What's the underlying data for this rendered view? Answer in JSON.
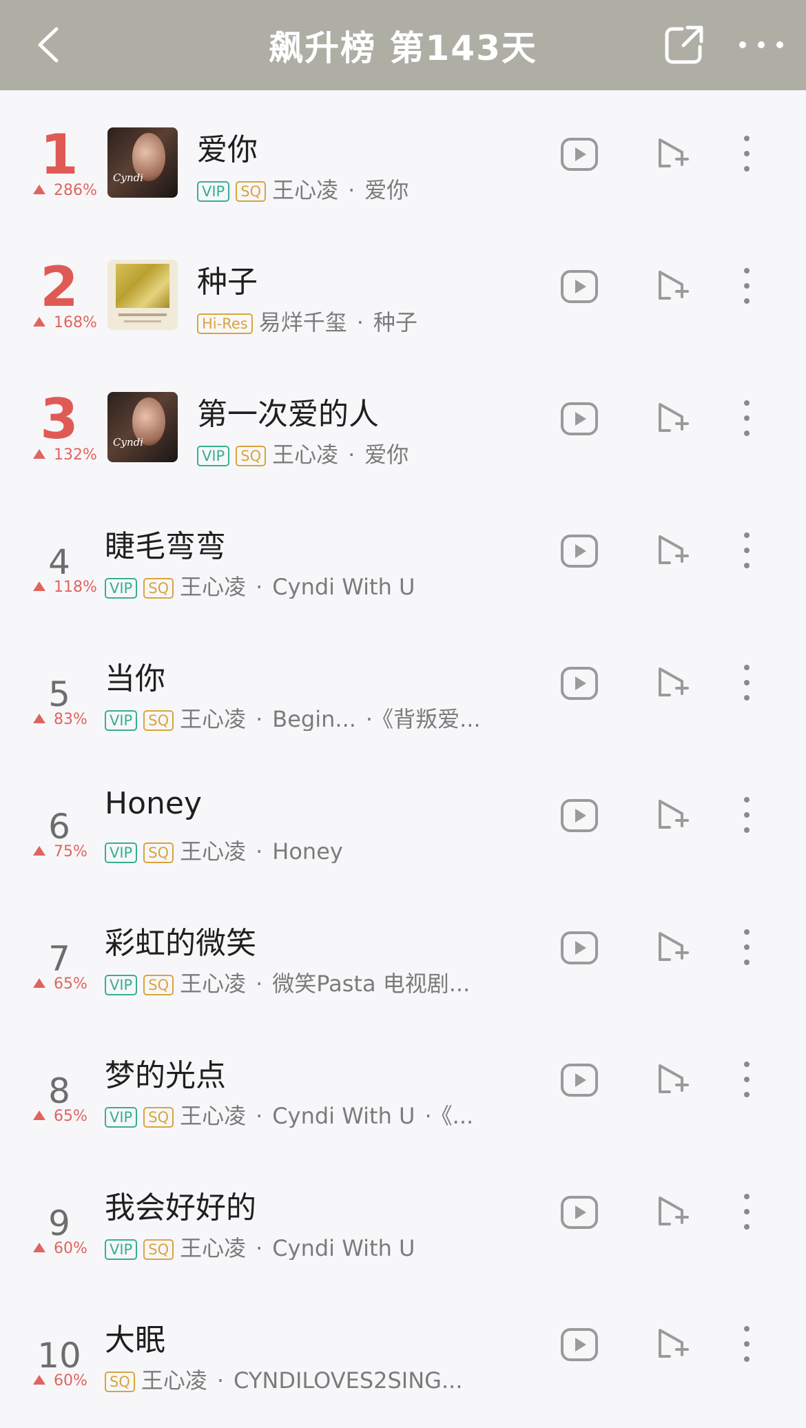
{
  "header": {
    "title": "飙升榜 第143天",
    "icons": {
      "back": "chevron-left-icon",
      "share": "share-icon",
      "more": "more-horizontal-icon"
    }
  },
  "colors": {
    "header_bg": "#aeaea5",
    "rank_highlight": "#e05a55",
    "rise": "#e0645e",
    "vip": "#36b08c",
    "sq": "#d9a43c"
  },
  "songs": [
    {
      "rank": "1",
      "change": "286%",
      "title": "爱你",
      "tags": [
        "VIP",
        "SQ"
      ],
      "artist": "王心凌",
      "album": "爱你",
      "cover": true
    },
    {
      "rank": "2",
      "change": "168%",
      "title": "种子",
      "tags": [
        "Hi-Res"
      ],
      "artist": "易烊千玺",
      "album": "种子",
      "cover": true
    },
    {
      "rank": "3",
      "change": "132%",
      "title": "第一次爱的人",
      "tags": [
        "VIP",
        "SQ"
      ],
      "artist": "王心凌",
      "album": "爱你",
      "cover": true
    },
    {
      "rank": "4",
      "change": "118%",
      "title": "睫毛弯弯",
      "tags": [
        "VIP",
        "SQ"
      ],
      "artist": "王心凌",
      "album": "Cyndi With U"
    },
    {
      "rank": "5",
      "change": "83%",
      "title": "当你",
      "tags": [
        "VIP",
        "SQ"
      ],
      "artist": "王心凌",
      "album": "Begin...",
      "extra": "《背叛爱..."
    },
    {
      "rank": "6",
      "change": "75%",
      "title": "Honey",
      "tags": [
        "VIP",
        "SQ"
      ],
      "artist": "王心凌",
      "album": "Honey"
    },
    {
      "rank": "7",
      "change": "65%",
      "title": "彩虹的微笑",
      "tags": [
        "VIP",
        "SQ"
      ],
      "artist": "王心凌",
      "album": "微笑Pasta 电视剧..."
    },
    {
      "rank": "8",
      "change": "65%",
      "title": "梦的光点",
      "tags": [
        "VIP",
        "SQ"
      ],
      "artist": "王心凌",
      "album": "Cyndi With U",
      "extra": "《..."
    },
    {
      "rank": "9",
      "change": "60%",
      "title": "我会好好的",
      "tags": [
        "VIP",
        "SQ"
      ],
      "artist": "王心凌",
      "album": "Cyndi With U"
    },
    {
      "rank": "10",
      "change": "60%",
      "title": "大眠",
      "tags": [
        "SQ"
      ],
      "artist": "王心凌",
      "album": "CYNDILOVES2SING..."
    }
  ],
  "row_icons": {
    "video": "video-play-icon",
    "add": "add-to-playlist-icon",
    "menu": "more-vertical-icon"
  },
  "separator": "·"
}
